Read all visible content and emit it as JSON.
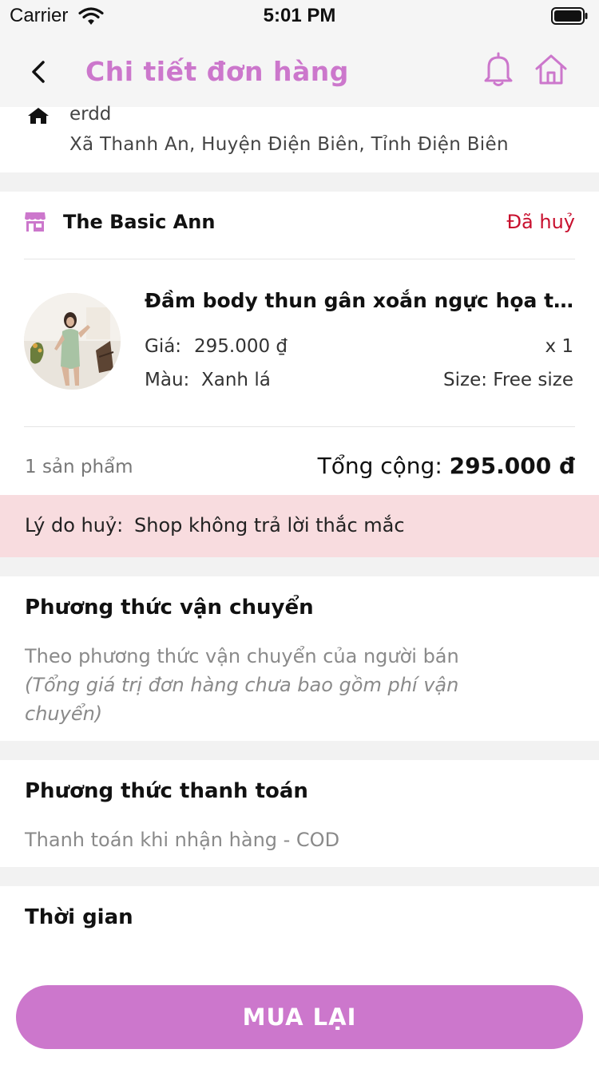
{
  "status_bar": {
    "carrier": "Carrier",
    "time": "5:01 PM"
  },
  "nav": {
    "title": "Chi tiết đơn hàng",
    "accent_color": "#cc77cc"
  },
  "address": {
    "name": "erdd",
    "line": "Xã Thanh An, Huyện Điện Biên, Tỉnh Điện Biên"
  },
  "order": {
    "shop_name": "The Basic Ann",
    "status": "Đã huỷ",
    "status_color": "#c8102e",
    "product": {
      "name": "Đầm body thun gân xoắn ngực họa tiết",
      "price_label": "Giá:",
      "price": "295.000 ₫",
      "quantity": "x 1",
      "color_label": "Màu:",
      "color": "Xanh lá",
      "size": "Size: Free size"
    },
    "item_count": "1 sản phẩm",
    "total_label": "Tổng cộng:",
    "total_value": "295.000 đ"
  },
  "cancel": {
    "label": "Lý do huỷ:",
    "reason": "Shop không trả lời thắc mắc"
  },
  "shipping": {
    "title": "Phương thức vận chuyển",
    "method": "Theo phương thức vận chuyển của người bán",
    "note": "(Tổng giá trị đơn hàng chưa bao gồm phí vận chuyển)"
  },
  "payment": {
    "title": "Phương thức thanh toán",
    "method": "Thanh toán khi nhận hàng - COD"
  },
  "time_section": {
    "title": "Thời gian"
  },
  "actions": {
    "rebuy_label": "MUA LẠI"
  }
}
